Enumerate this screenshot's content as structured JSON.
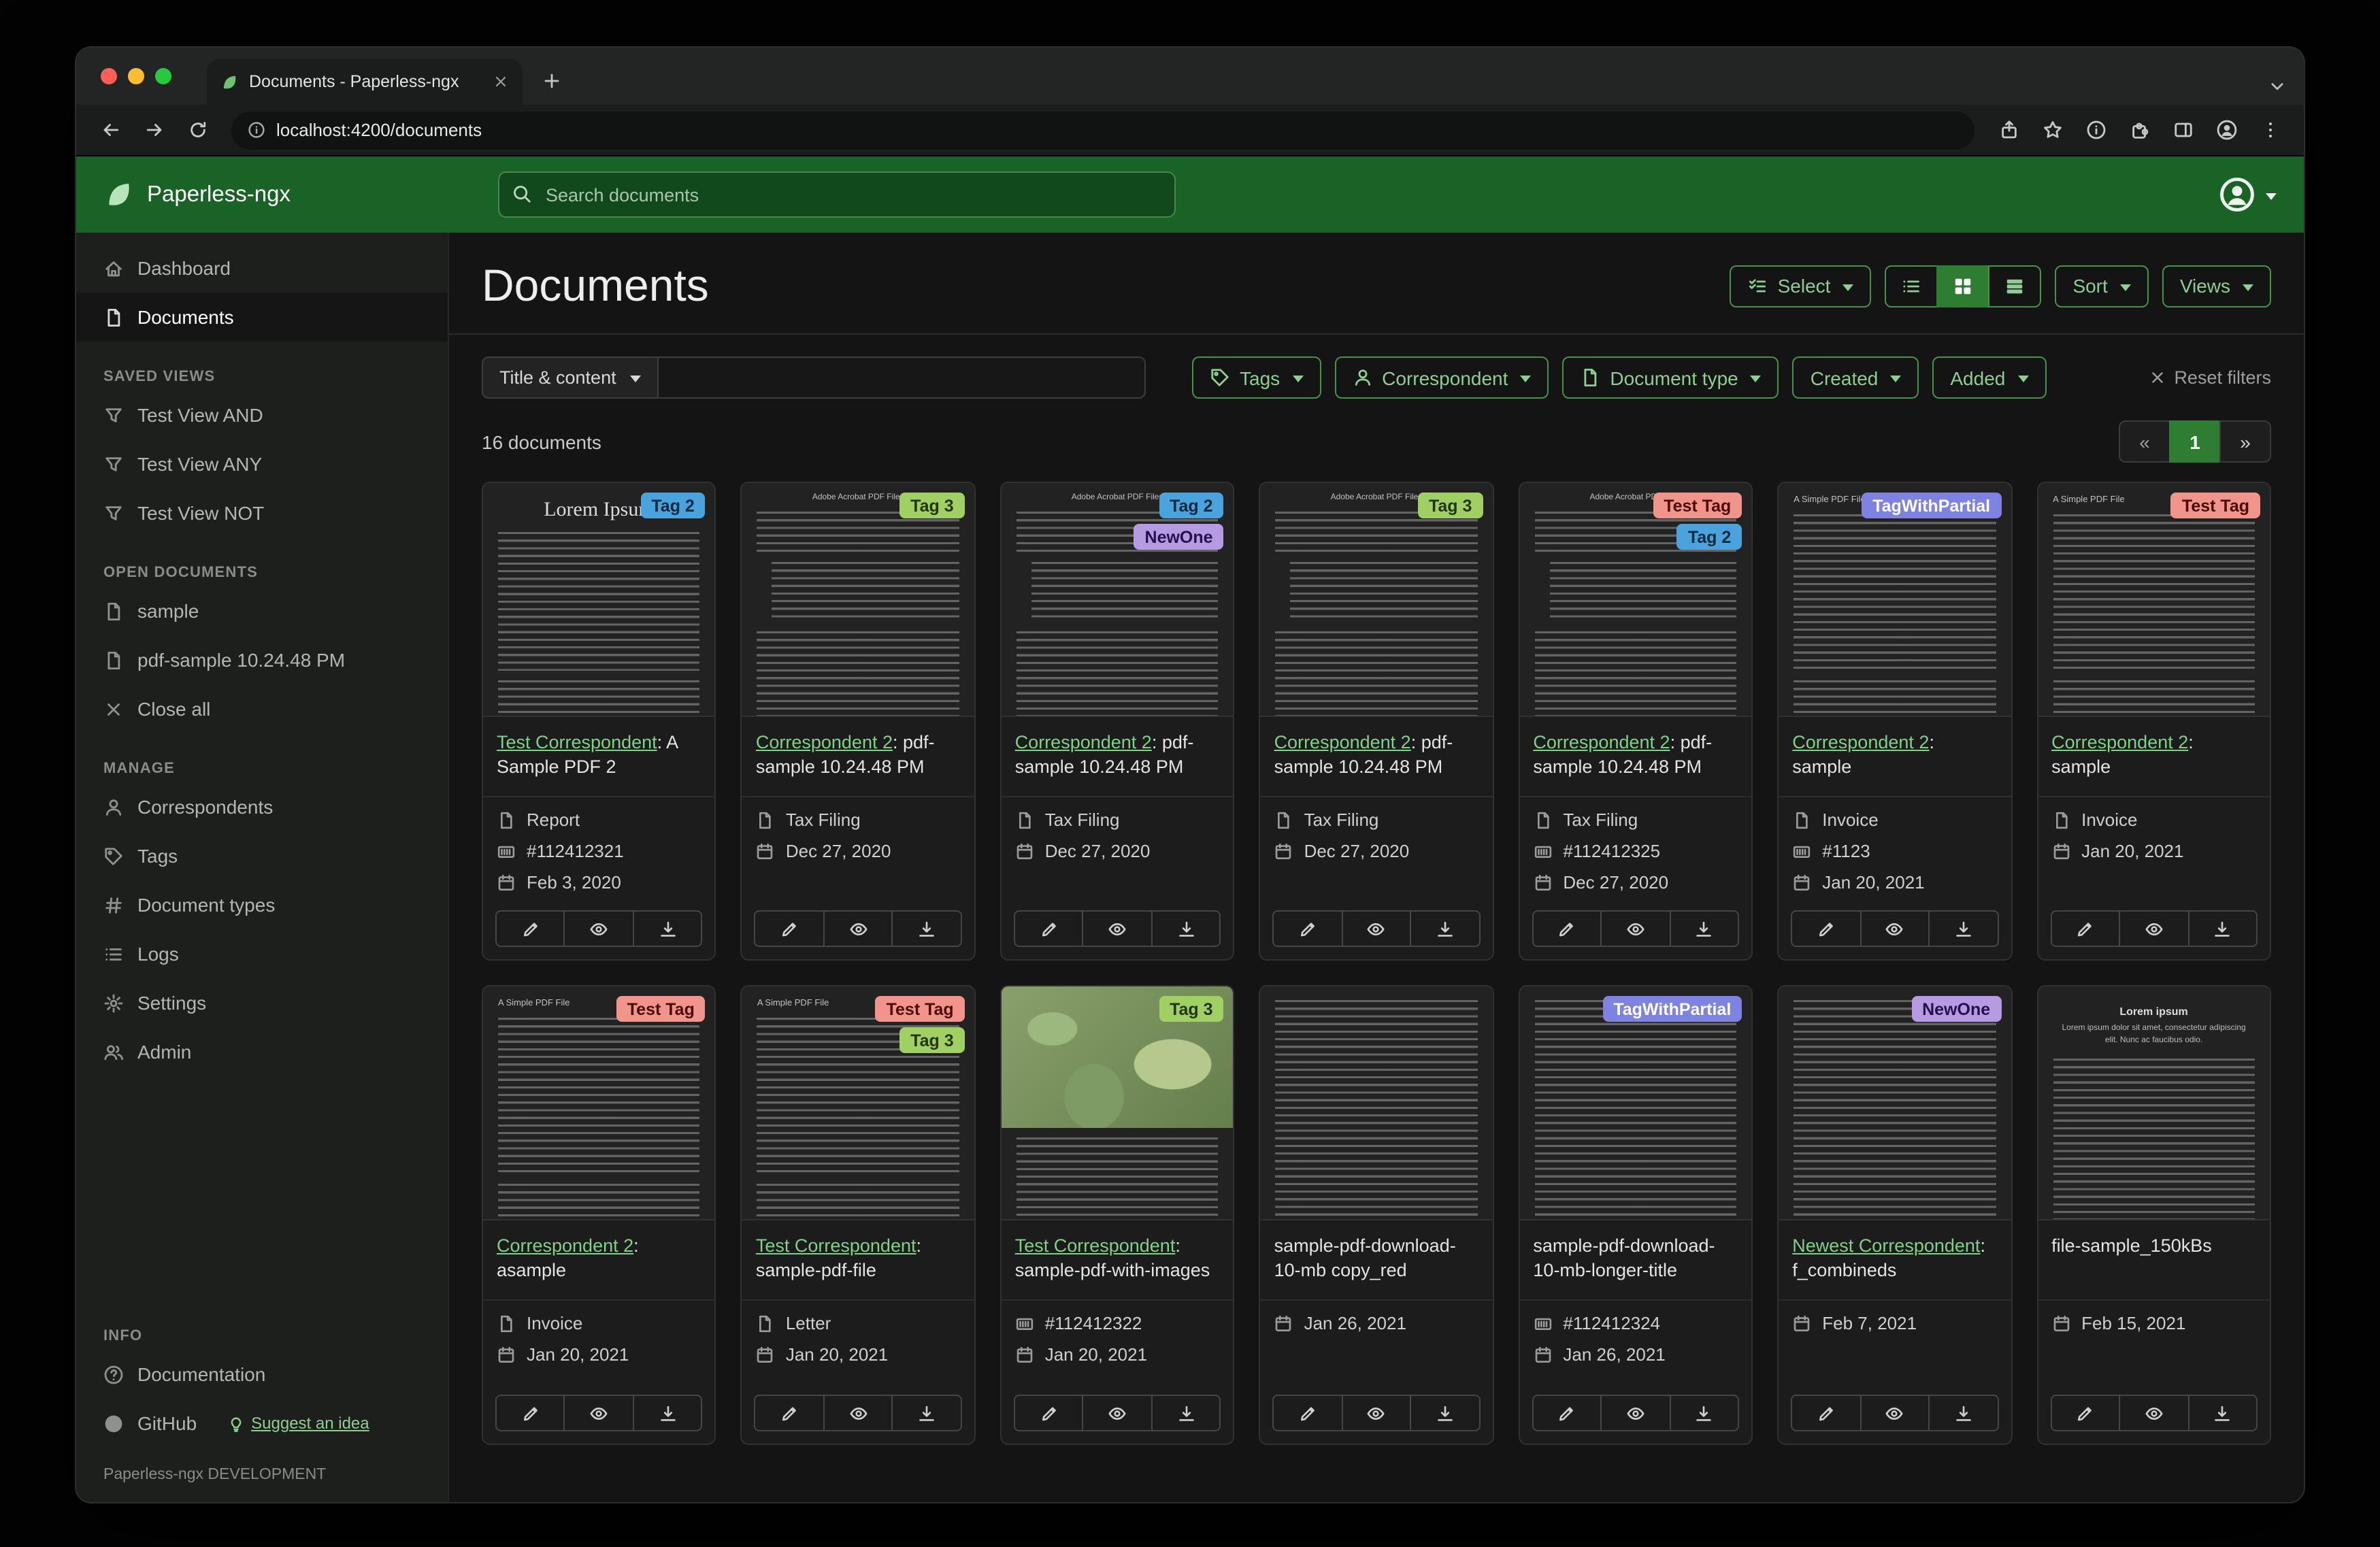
{
  "browser": {
    "tab_title": "Documents - Paperless-ngx",
    "url": "localhost:4200/documents"
  },
  "header": {
    "app_name": "Paperless-ngx",
    "search_placeholder": "Search documents"
  },
  "sidebar": {
    "nav": [
      {
        "label": "Dashboard",
        "icon": "house",
        "active": false
      },
      {
        "label": "Documents",
        "icon": "file",
        "active": true
      }
    ],
    "sections": [
      {
        "title": "SAVED VIEWS",
        "items": [
          {
            "label": "Test View AND",
            "icon": "funnel"
          },
          {
            "label": "Test View ANY",
            "icon": "funnel"
          },
          {
            "label": "Test View NOT",
            "icon": "funnel"
          }
        ]
      },
      {
        "title": "OPEN DOCUMENTS",
        "items": [
          {
            "label": "sample",
            "icon": "file"
          },
          {
            "label": "pdf-sample 10.24.48 PM",
            "icon": "file"
          },
          {
            "label": "Close all",
            "icon": "x"
          }
        ]
      },
      {
        "title": "MANAGE",
        "items": [
          {
            "label": "Correspondents",
            "icon": "person"
          },
          {
            "label": "Tags",
            "icon": "tag"
          },
          {
            "label": "Document types",
            "icon": "hash"
          },
          {
            "label": "Logs",
            "icon": "list"
          },
          {
            "label": "Settings",
            "icon": "gear"
          },
          {
            "label": "Admin",
            "icon": "people"
          }
        ]
      },
      {
        "title": "INFO",
        "items": [
          {
            "label": "Documentation",
            "icon": "question"
          },
          {
            "label": "GitHub",
            "icon": "github",
            "extra": {
              "label": "Suggest an idea",
              "icon": "bulb"
            }
          }
        ]
      }
    ],
    "footer": "Paperless-ngx DEVELOPMENT"
  },
  "page": {
    "title": "Documents",
    "toolbar": {
      "select": "Select",
      "sort": "Sort",
      "views": "Views"
    },
    "filters": {
      "title_content": "Title & content",
      "buttons": [
        {
          "label": "Tags",
          "icon": "tag"
        },
        {
          "label": "Correspondent",
          "icon": "person"
        },
        {
          "label": "Document type",
          "icon": "file"
        },
        {
          "label": "Created"
        },
        {
          "label": "Added"
        }
      ],
      "reset": "Reset filters"
    },
    "count": "16 documents",
    "pagination": {
      "prev": "«",
      "page": "1",
      "next": "»"
    }
  },
  "tag_colors": {
    "Tag 2": {
      "bg": "#4aa3dd",
      "fg": "#0a2a3f"
    },
    "Tag 3": {
      "bg": "#a0cf63",
      "fg": "#223608"
    },
    "NewOne": {
      "bg": "#b59ce2",
      "fg": "#26104e"
    },
    "Test Tag": {
      "bg": "#f1948c",
      "fg": "#4c0d08"
    },
    "TagWithPartial": {
      "bg": "#7e82e0",
      "fg": "#ffffff"
    }
  },
  "cards": [
    {
      "thumb": "lorem",
      "thumb_title": "Lorem Ipsum",
      "tags": [
        "Tag 2"
      ],
      "link": "Test Correspondent",
      "title_rest": ": A Sample PDF 2",
      "doc_type": "Report",
      "asn": "#112412321",
      "date": "Feb 3, 2020"
    },
    {
      "thumb": "acrobat",
      "thumb_title": "Adobe Acrobat PDF Files",
      "tags": [
        "Tag 3"
      ],
      "link": "Correspondent 2",
      "title_rest": ": pdf-sample 10.24.48 PM",
      "doc_type": "Tax Filing",
      "date": "Dec 27, 2020"
    },
    {
      "thumb": "acrobat",
      "thumb_title": "Adobe Acrobat PDF Files",
      "tags": [
        "Tag 2",
        "NewOne"
      ],
      "link": "Correspondent 2",
      "title_rest": ": pdf-sample 10.24.48 PM",
      "doc_type": "Tax Filing",
      "date": "Dec 27, 2020"
    },
    {
      "thumb": "acrobat",
      "thumb_title": "Adobe Acrobat PDF Files",
      "tags": [
        "Tag 3"
      ],
      "link": "Correspondent 2",
      "title_rest": ": pdf-sample 10.24.48 PM",
      "doc_type": "Tax Filing",
      "date": "Dec 27, 2020"
    },
    {
      "thumb": "acrobat",
      "thumb_title": "Adobe Acrobat PDF Files",
      "tags": [
        "Test Tag",
        "Tag 2"
      ],
      "link": "Correspondent 2",
      "title_rest": ": pdf-sample 10.24.48 PM",
      "doc_type": "Tax Filing",
      "asn": "#112412325",
      "date": "Dec 27, 2020"
    },
    {
      "thumb": "simple",
      "thumb_title": "A Simple PDF File",
      "tags": [
        "TagWithPartial"
      ],
      "link": "Correspondent 2",
      "title_rest": ": sample",
      "doc_type": "Invoice",
      "asn": "#1123",
      "date": "Jan 20, 2021"
    },
    {
      "thumb": "simple",
      "thumb_title": "A Simple PDF File",
      "tags": [
        "Test Tag"
      ],
      "link": "Correspondent 2",
      "title_rest": ": sample",
      "doc_type": "Invoice",
      "date": "Jan 20, 2021"
    },
    {
      "thumb": "simple",
      "thumb_title": "A Simple PDF File",
      "tags": [
        "Test Tag"
      ],
      "link": "Correspondent 2",
      "title_rest": ": asample",
      "doc_type": "Invoice",
      "date": "Jan 20, 2021"
    },
    {
      "thumb": "simple",
      "thumb_title": "A Simple PDF File",
      "tags": [
        "Test Tag",
        "Tag 3"
      ],
      "link": "Test Correspondent",
      "title_rest": ": sample-pdf-file",
      "doc_type": "Letter",
      "date": "Jan 20, 2021"
    },
    {
      "thumb": "map",
      "tags": [
        "Tag 3"
      ],
      "link": "Test Correspondent",
      "title_rest": ": sample-pdf-with-images",
      "asn": "#112412322",
      "date": "Jan 20, 2021"
    },
    {
      "thumb": "text",
      "tags": [],
      "title": "sample-pdf-download-10-mb copy_red",
      "date": "Jan 26, 2021"
    },
    {
      "thumb": "text",
      "tags": [
        "TagWithPartial"
      ],
      "title": "sample-pdf-download-10-mb-longer-title",
      "asn": "#112412324",
      "date": "Jan 26, 2021"
    },
    {
      "thumb": "text",
      "tags": [
        "NewOne"
      ],
      "link": "Newest Correspondent",
      "title_rest": ": f_combineds",
      "date": "Feb 7, 2021"
    },
    {
      "thumb": "lorem2",
      "thumb_title": "Lorem ipsum",
      "thumb_sub": "Lorem ipsum dolor sit amet, consectetur adipiscing elit. Nunc ac faucibus odio.",
      "tags": [],
      "title": "file-sample_150kBs",
      "date": "Feb 15, 2021"
    }
  ]
}
